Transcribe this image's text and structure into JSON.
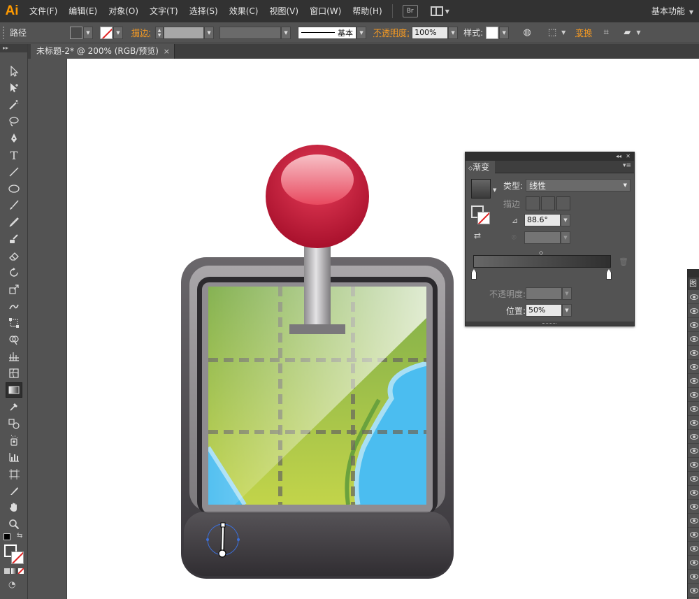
{
  "app": {
    "logo": "Ai"
  },
  "menu": [
    "文件(F)",
    "编辑(E)",
    "对象(O)",
    "文字(T)",
    "选择(S)",
    "效果(C)",
    "视图(V)",
    "窗口(W)",
    "帮助(H)"
  ],
  "menubar_buttons": {
    "bridge": "Br"
  },
  "workspace": "基本功能",
  "control": {
    "selection_label": "路径",
    "stroke_link": "描边:",
    "stroke_profile": "基本",
    "opacity_link": "不透明度:",
    "opacity_value": "100%",
    "style_label": "样式:",
    "transform_link": "变换"
  },
  "document_tab": {
    "title": "未标题-2* @ 200% (RGB/预览)",
    "close": "×"
  },
  "tools_header": "▸▸",
  "gradient_panel": {
    "tab": "渐变",
    "type_label": "类型:",
    "type_value": "线性",
    "stroke_label": "描边",
    "angle_value": "88.6°",
    "opacity_label": "不透明度:",
    "position_label": "位置:",
    "position_value": "50%",
    "colors": {
      "stop_left": "#676767",
      "stop_right": "#2f2f2f"
    }
  },
  "layers_panel": {
    "tab": "图"
  },
  "colors": {
    "menubar_bg": "#323232",
    "panel_bg": "#535353",
    "accent_orange": "#f59a23",
    "logo_orange": "#ff9a00",
    "artboard": "#ffffff"
  },
  "icons": [
    "selection-tool-icon",
    "direct-selection-tool-icon",
    "magic-wand-icon",
    "lasso-icon",
    "pen-tool-icon",
    "type-tool-icon",
    "line-tool-icon",
    "ellipse-tool-icon",
    "paintbrush-icon",
    "pencil-icon",
    "blob-brush-icon",
    "eraser-icon",
    "rotate-icon",
    "scale-icon",
    "warp-icon",
    "free-transform-icon",
    "shape-builder-icon",
    "perspective-grid-icon",
    "mesh-icon",
    "gradient-tool-icon",
    "eyedropper-icon",
    "blend-icon",
    "symbol-sprayer-icon",
    "graph-icon",
    "artboard-icon",
    "slice-icon",
    "hand-icon",
    "zoom-icon"
  ]
}
